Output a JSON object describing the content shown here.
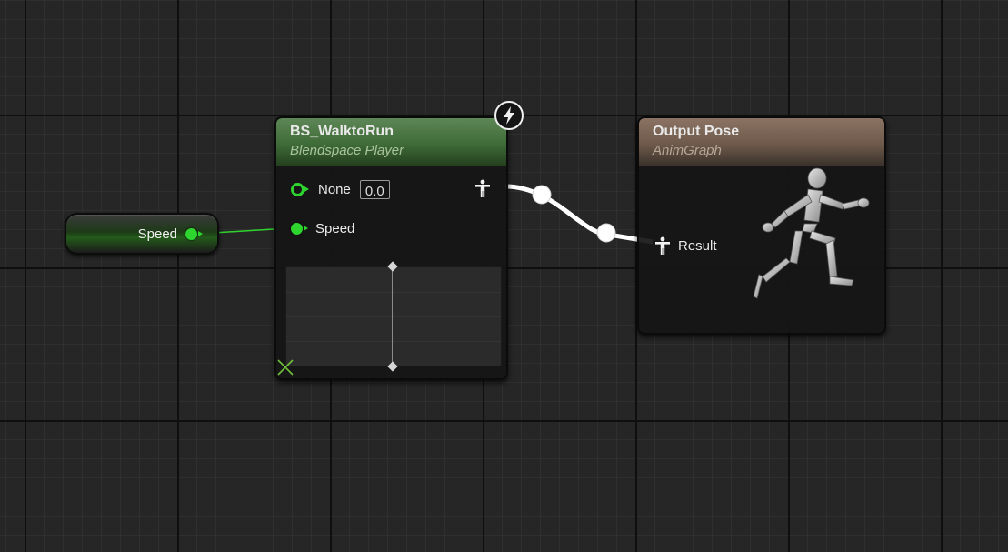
{
  "graph": {
    "variable_node": {
      "label": "Speed",
      "pin_color": "#2fd52f"
    },
    "blendspace_node": {
      "title": "BS_WalktoRun",
      "subtitle": "Blendspace Player",
      "header_color": "#4a7842",
      "inputs": [
        {
          "name": "None",
          "value": "0.0",
          "pin_style": "ring"
        },
        {
          "name": "Speed",
          "pin_style": "filled"
        }
      ],
      "output_icon": "person-pose-icon",
      "badge_icon": "lightning-bolt-icon"
    },
    "output_node": {
      "title": "Output Pose",
      "subtitle": "AnimGraph",
      "header_color": "#7a6454",
      "input": {
        "name": "Result",
        "icon": "person-pose-icon"
      },
      "preview_icon": "running-mannequin-icon"
    },
    "wire_colors": {
      "float": "#2fd52f",
      "pose": "#ffffff"
    }
  }
}
